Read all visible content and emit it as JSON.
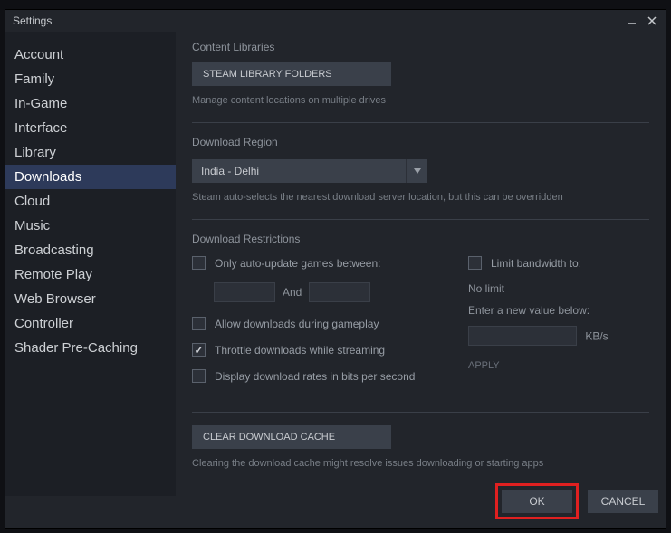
{
  "window": {
    "title": "Settings"
  },
  "sidebar": {
    "items": [
      {
        "label": "Account"
      },
      {
        "label": "Family"
      },
      {
        "label": "In-Game"
      },
      {
        "label": "Interface"
      },
      {
        "label": "Library"
      },
      {
        "label": "Downloads",
        "active": true
      },
      {
        "label": "Cloud"
      },
      {
        "label": "Music"
      },
      {
        "label": "Broadcasting"
      },
      {
        "label": "Remote Play"
      },
      {
        "label": "Web Browser"
      },
      {
        "label": "Controller"
      },
      {
        "label": "Shader Pre-Caching"
      }
    ]
  },
  "content_libraries": {
    "title": "Content Libraries",
    "button": "STEAM LIBRARY FOLDERS",
    "desc": "Manage content locations on multiple drives"
  },
  "download_region": {
    "title": "Download Region",
    "selected": "India - Delhi",
    "desc": "Steam auto-selects the nearest download server location, but this can be overridden"
  },
  "restrictions": {
    "title": "Download Restrictions",
    "auto_update": "Only auto-update games between:",
    "and": "And",
    "allow_gameplay": "Allow downloads during gameplay",
    "throttle": "Throttle downloads while streaming",
    "bits": "Display download rates in bits per second",
    "limit_bw": "Limit bandwidth to:",
    "no_limit": "No limit",
    "enter_value": "Enter a new value below:",
    "unit": "KB/s",
    "apply": "APPLY"
  },
  "cache": {
    "button": "CLEAR DOWNLOAD CACHE",
    "desc": "Clearing the download cache might resolve issues downloading or starting apps"
  },
  "footer": {
    "ok": "OK",
    "cancel": "CANCEL"
  }
}
